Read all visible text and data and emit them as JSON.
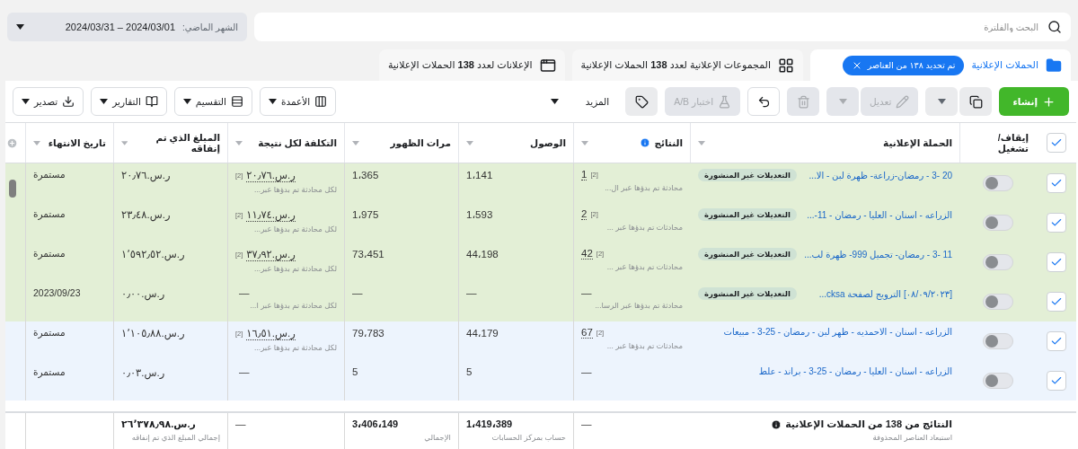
{
  "top_bar": {
    "search": {
      "placeholder": "البحث والفلترة"
    },
    "date_range": {
      "label": "الشهر الماضي:",
      "value": "2024/03/01 – 2024/03/31"
    }
  },
  "tabs": [
    {
      "label": "الحملات الإعلانية",
      "selected": true,
      "chip": "تم تحديد ١٣٨ من العناصر"
    },
    {
      "label": "المجموعات الإعلانية لعدد **138** الحملات الإعلانية",
      "selected": false
    },
    {
      "label": "الإعلانات لعدد **138** الحملات الإعلانية",
      "selected": false
    }
  ],
  "toolbar": {
    "actions": [
      {
        "kind": "primary",
        "label": "إنشاء"
      },
      {
        "kind": "split",
        "disabled": false
      },
      {
        "kind": "split",
        "label": "تعديل",
        "disabled": true
      },
      {
        "kind": "icon",
        "disabled": true
      },
      {
        "kind": "icon",
        "disabled": false
      },
      {
        "kind": "button",
        "label": "اختبار A/B",
        "disabled": true
      },
      {
        "kind": "icon",
        "disabled": false
      },
      {
        "kind": "menu",
        "label": "المزيد",
        "disabled": false
      }
    ],
    "views": [
      {
        "label": "الأعمدة"
      },
      {
        "label": "التقسيم"
      },
      {
        "label": "التقارير"
      },
      {
        "label": "تصدير"
      }
    ]
  },
  "table": {
    "select_all_checked": true,
    "columns": [
      {
        "label": "إيقاف/ تشغيل"
      },
      {
        "label": "الحملة الإعلانية"
      },
      {
        "label": "النتائج",
        "info": true
      },
      {
        "label": "الوصول"
      },
      {
        "label": "مرات الظهور"
      },
      {
        "label": "التكلفة لكل نتيجة"
      },
      {
        "label": "المبلغ الذي تم إنفاقه"
      },
      {
        "label": "تاريخ الانتهاء"
      }
    ],
    "rows": [
      {
        "checked": true,
        "on": false,
        "color": "#e3efd6",
        "name": "20 -3 - رمضان-زراعة- ظهرة لبن - الا...",
        "badge": "التعديلات غير المنشورة",
        "result": "1",
        "result_note": "[2]",
        "result_sub": "محادثة تم بدؤها عبر ال...",
        "reach": "1،141",
        "impressions": "1،365",
        "cost": "ر.س.٢٠٫٧٦",
        "cost_note": "[2]",
        "cost_sub": "لكل محادثة تم بدؤها عبر...",
        "spent": "ر.س.٢٠٫٧٦",
        "end": "مستمرة"
      },
      {
        "checked": true,
        "on": false,
        "color": "#e3efd6",
        "name": "الزراعه - اسنان - العليا - رمضان - 11-...",
        "badge": "التعديلات غير المنشورة",
        "result": "2",
        "result_note": "[2]",
        "result_sub": "محادثات تم بدؤها عبر ...",
        "reach": "1،593",
        "impressions": "1،975",
        "cost": "ر.س.١١٫٧٤",
        "cost_note": "[2]",
        "cost_sub": "لكل محادثة تم بدؤها عبر...",
        "spent": "ر.س.٢٣٫٤٨",
        "end": "مستمرة"
      },
      {
        "checked": true,
        "on": false,
        "color": "#e3efd6",
        "name": "11 -3 - رمضان- تجميل 999- ظهرة لب...",
        "badge": "التعديلات غير المنشورة",
        "result": "42",
        "result_note": "[2]",
        "result_sub": "محادثات تم بدؤها عبر ...",
        "reach": "44،198",
        "impressions": "73،451",
        "cost": "ر.س.٣٧٫٩٢",
        "cost_note": "[2]",
        "cost_sub": "لكل محادثة تم بدؤها عبر...",
        "spent": "ر.س.١٬٥٩٢٫٥٢",
        "end": "مستمرة"
      },
      {
        "checked": true,
        "on": false,
        "color": "#e3efd6",
        "name": "[٠٨/٠٩/٢٠٢٣] الترويج لصفحة cksa...",
        "badge": "التعديلات غير المنشورة",
        "result": "—",
        "result_sub": "محادثة تم بدؤها عبر الرسا...",
        "reach": "—",
        "impressions": "—",
        "cost": "—",
        "cost_sub": "لكل محادثة تم بدؤها عبر ا...",
        "spent": "ر.س.٠٫٠٠",
        "end": "2023/09/23"
      },
      {
        "checked": true,
        "on": false,
        "color": "#edf4fd",
        "name": "الزراعه - اسنان - الاحمديه - ظهر لبن - رمضان - 25-3 - مبيعات",
        "result": "67",
        "result_note": "[2]",
        "result_sub": "محادثات تم بدؤها عبر ...",
        "reach": "44،179",
        "impressions": "79،783",
        "cost": "ر.س.١٦٫٥١",
        "cost_note": "[2]",
        "cost_sub": "لكل محادثة تم بدؤها عبر...",
        "spent": "ر.س.١٬١٠٥٫٨٨",
        "end": "مستمرة"
      },
      {
        "checked": true,
        "on": false,
        "color": "#edf4fd",
        "name": "الزراعه - اسنان - العليا - رمضان - 25-3 - براند - علط",
        "result": "—",
        "reach": "5",
        "impressions": "5",
        "cost": "—",
        "spent": "ر.س.٠٫٠٣",
        "end": "مستمرة"
      }
    ],
    "totals": {
      "label": "النتائج من 138 من الحملات الإعلانية",
      "label_sub": "استبعاد العناصر المحذوفة",
      "result": "—",
      "reach": "1،419،389",
      "reach_sub": "حساب بمركز الحسابات",
      "impressions": "3،406،149",
      "impressions_sub": "الإجمالي",
      "cost": "—",
      "spent": "ر.س.٢٦٬٣٧٨٫٩٨",
      "spent_sub": "إجمالي المبلغ الذي تم إنفاقه"
    }
  }
}
